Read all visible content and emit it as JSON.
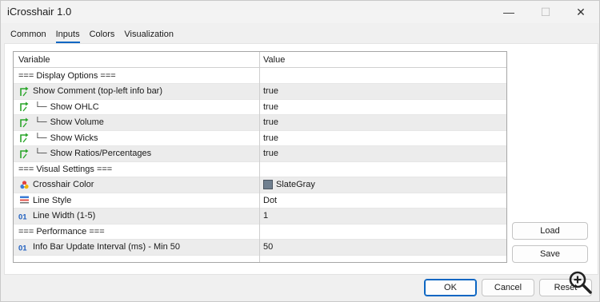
{
  "window": {
    "title": "iCrosshair 1.0"
  },
  "controls": {
    "minimize": "—",
    "maximize": "☐",
    "close": "✕"
  },
  "tabs": [
    {
      "label": "Common",
      "active": false
    },
    {
      "label": "Inputs",
      "active": true
    },
    {
      "label": "Colors",
      "active": false
    },
    {
      "label": "Visualization",
      "active": false
    }
  ],
  "table": {
    "headers": {
      "variable": "Variable",
      "value": "Value"
    },
    "rows": [
      {
        "icon": "none",
        "indent": false,
        "variable": "=== Display Options ===",
        "value": ""
      },
      {
        "icon": "bool-arrow-icon",
        "indent": false,
        "variable": "Show Comment (top-left info bar)",
        "value": "true"
      },
      {
        "icon": "bool-arrow-icon",
        "indent": true,
        "variable": "Show OHLC",
        "value": "true"
      },
      {
        "icon": "bool-arrow-icon",
        "indent": true,
        "variable": "Show Volume",
        "value": "true"
      },
      {
        "icon": "bool-arrow-icon",
        "indent": true,
        "variable": "Show Wicks",
        "value": "true"
      },
      {
        "icon": "bool-arrow-icon",
        "indent": true,
        "variable": "Show Ratios/Percentages",
        "value": "true"
      },
      {
        "icon": "none",
        "indent": false,
        "variable": "=== Visual Settings ===",
        "value": ""
      },
      {
        "icon": "color-palette-icon",
        "indent": false,
        "variable": "Crosshair Color",
        "value": "SlateGray",
        "swatch": "#708090"
      },
      {
        "icon": "line-style-icon",
        "indent": false,
        "variable": "Line Style",
        "value": "Dot"
      },
      {
        "icon": "integer-icon",
        "indent": false,
        "variable": "Line Width (1-5)",
        "value": "1"
      },
      {
        "icon": "none",
        "indent": false,
        "variable": "=== Performance ===",
        "value": ""
      },
      {
        "icon": "integer-icon",
        "indent": false,
        "variable": "Info Bar Update Interval (ms) - Min 50",
        "value": "50"
      }
    ],
    "indent_glyph": "└─"
  },
  "side_buttons": {
    "load": "Load",
    "save": "Save"
  },
  "footer": {
    "ok": "OK",
    "cancel": "Cancel",
    "reset": "Reset"
  },
  "colors": {
    "accent": "#0b66c3",
    "bool_icon": "#2aa52a",
    "int_icon": "#1f5fbf"
  }
}
